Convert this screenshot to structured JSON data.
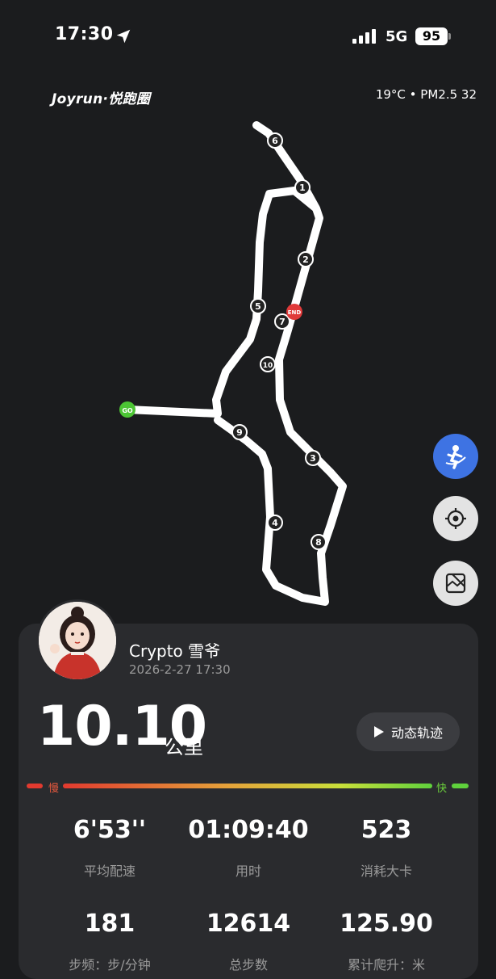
{
  "status_bar": {
    "time": "17:30",
    "network": "5G",
    "battery": "95"
  },
  "header": {
    "brand": "Joyrun·悦跑圈",
    "weather": "19°C • PM2.5 32"
  },
  "route": {
    "start_label": "GO",
    "end_label": "END",
    "km_markers": [
      "1",
      "2",
      "3",
      "4",
      "5",
      "6",
      "7",
      "8",
      "9",
      "10"
    ]
  },
  "user": {
    "name": "Crypto 雪爷",
    "date": "2026-2-27 17:30"
  },
  "summary": {
    "distance": "10.10",
    "distance_unit": "公里",
    "replay_label": "动态轨迹"
  },
  "pace_scale": {
    "slow_label": "慢",
    "fast_label": "快"
  },
  "stats": [
    {
      "value": "6'53''",
      "label": "平均配速"
    },
    {
      "value": "01:09:40",
      "label": "用时"
    },
    {
      "value": "523",
      "label": "消耗大卡"
    },
    {
      "value": "181",
      "label": "步频：步/分钟"
    },
    {
      "value": "12614",
      "label": "总步数"
    },
    {
      "value": "125.90",
      "label": "累计爬升：米"
    }
  ],
  "colors": {
    "accent": "#3e73e3",
    "start": "#4cc534",
    "end": "#e03a3a",
    "slow": "#e8593d",
    "fast": "#6cd13c"
  }
}
